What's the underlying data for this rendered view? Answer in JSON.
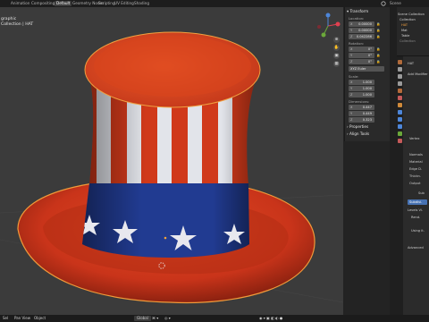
{
  "top_tabs": [
    "Animation",
    "Compositing",
    "Default",
    "Geometry Nodes",
    "Scripting",
    "UV Editing",
    "Shading"
  ],
  "active_tab": "Default",
  "scene_label": "Scene",
  "viewport": {
    "view_label_1": "graphic",
    "view_label_2": "Collection | HAT"
  },
  "n_panel": {
    "transform_header": "Transform",
    "location_label": "Location:",
    "location": [
      {
        "axis": "X",
        "value": "0.00000"
      },
      {
        "axis": "Y",
        "value": "0.00000"
      },
      {
        "axis": "Z",
        "value": "0.042286"
      }
    ],
    "rotation_label": "Rotation:",
    "rotation": [
      {
        "axis": "X",
        "value": "0°"
      },
      {
        "axis": "Y",
        "value": "0°"
      },
      {
        "axis": "Z",
        "value": "0°"
      }
    ],
    "rotation_mode": "XYZ Euler",
    "scale_label": "Scale:",
    "scale": [
      {
        "axis": "X",
        "value": "1.000"
      },
      {
        "axis": "Y",
        "value": "1.000"
      },
      {
        "axis": "Z",
        "value": "1.000"
      }
    ],
    "dimensions_label": "Dimensions:",
    "dimensions": [
      {
        "axis": "X",
        "value": "0.447"
      },
      {
        "axis": "Y",
        "value": "0.449"
      },
      {
        "axis": "Z",
        "value": "0.323"
      }
    ],
    "properties_header": "Properties",
    "align_header": "Align Tools"
  },
  "outliner": {
    "items": [
      "Scene Collection",
      "Collection",
      "HAT",
      "Mat",
      "Table",
      "Collection"
    ]
  },
  "properties_editor": {
    "object_name": "HAT",
    "add_modifier": "Add Modifier",
    "labels": [
      "Vertex",
      "Normals",
      "Material",
      "Edge D.",
      "Thickn.",
      "Output",
      "Sub",
      "Subdivi.",
      "Levels Vi.",
      "Rend.",
      "Using it.",
      "Advanced"
    ]
  },
  "status_bar": {
    "left_items": [
      "Sel",
      "Pan View",
      "Object"
    ],
    "mode": "Global",
    "colors": {
      "accent": "#4772b3",
      "hat_red": "#d53a1a",
      "hat_blue": "#213b91"
    }
  }
}
